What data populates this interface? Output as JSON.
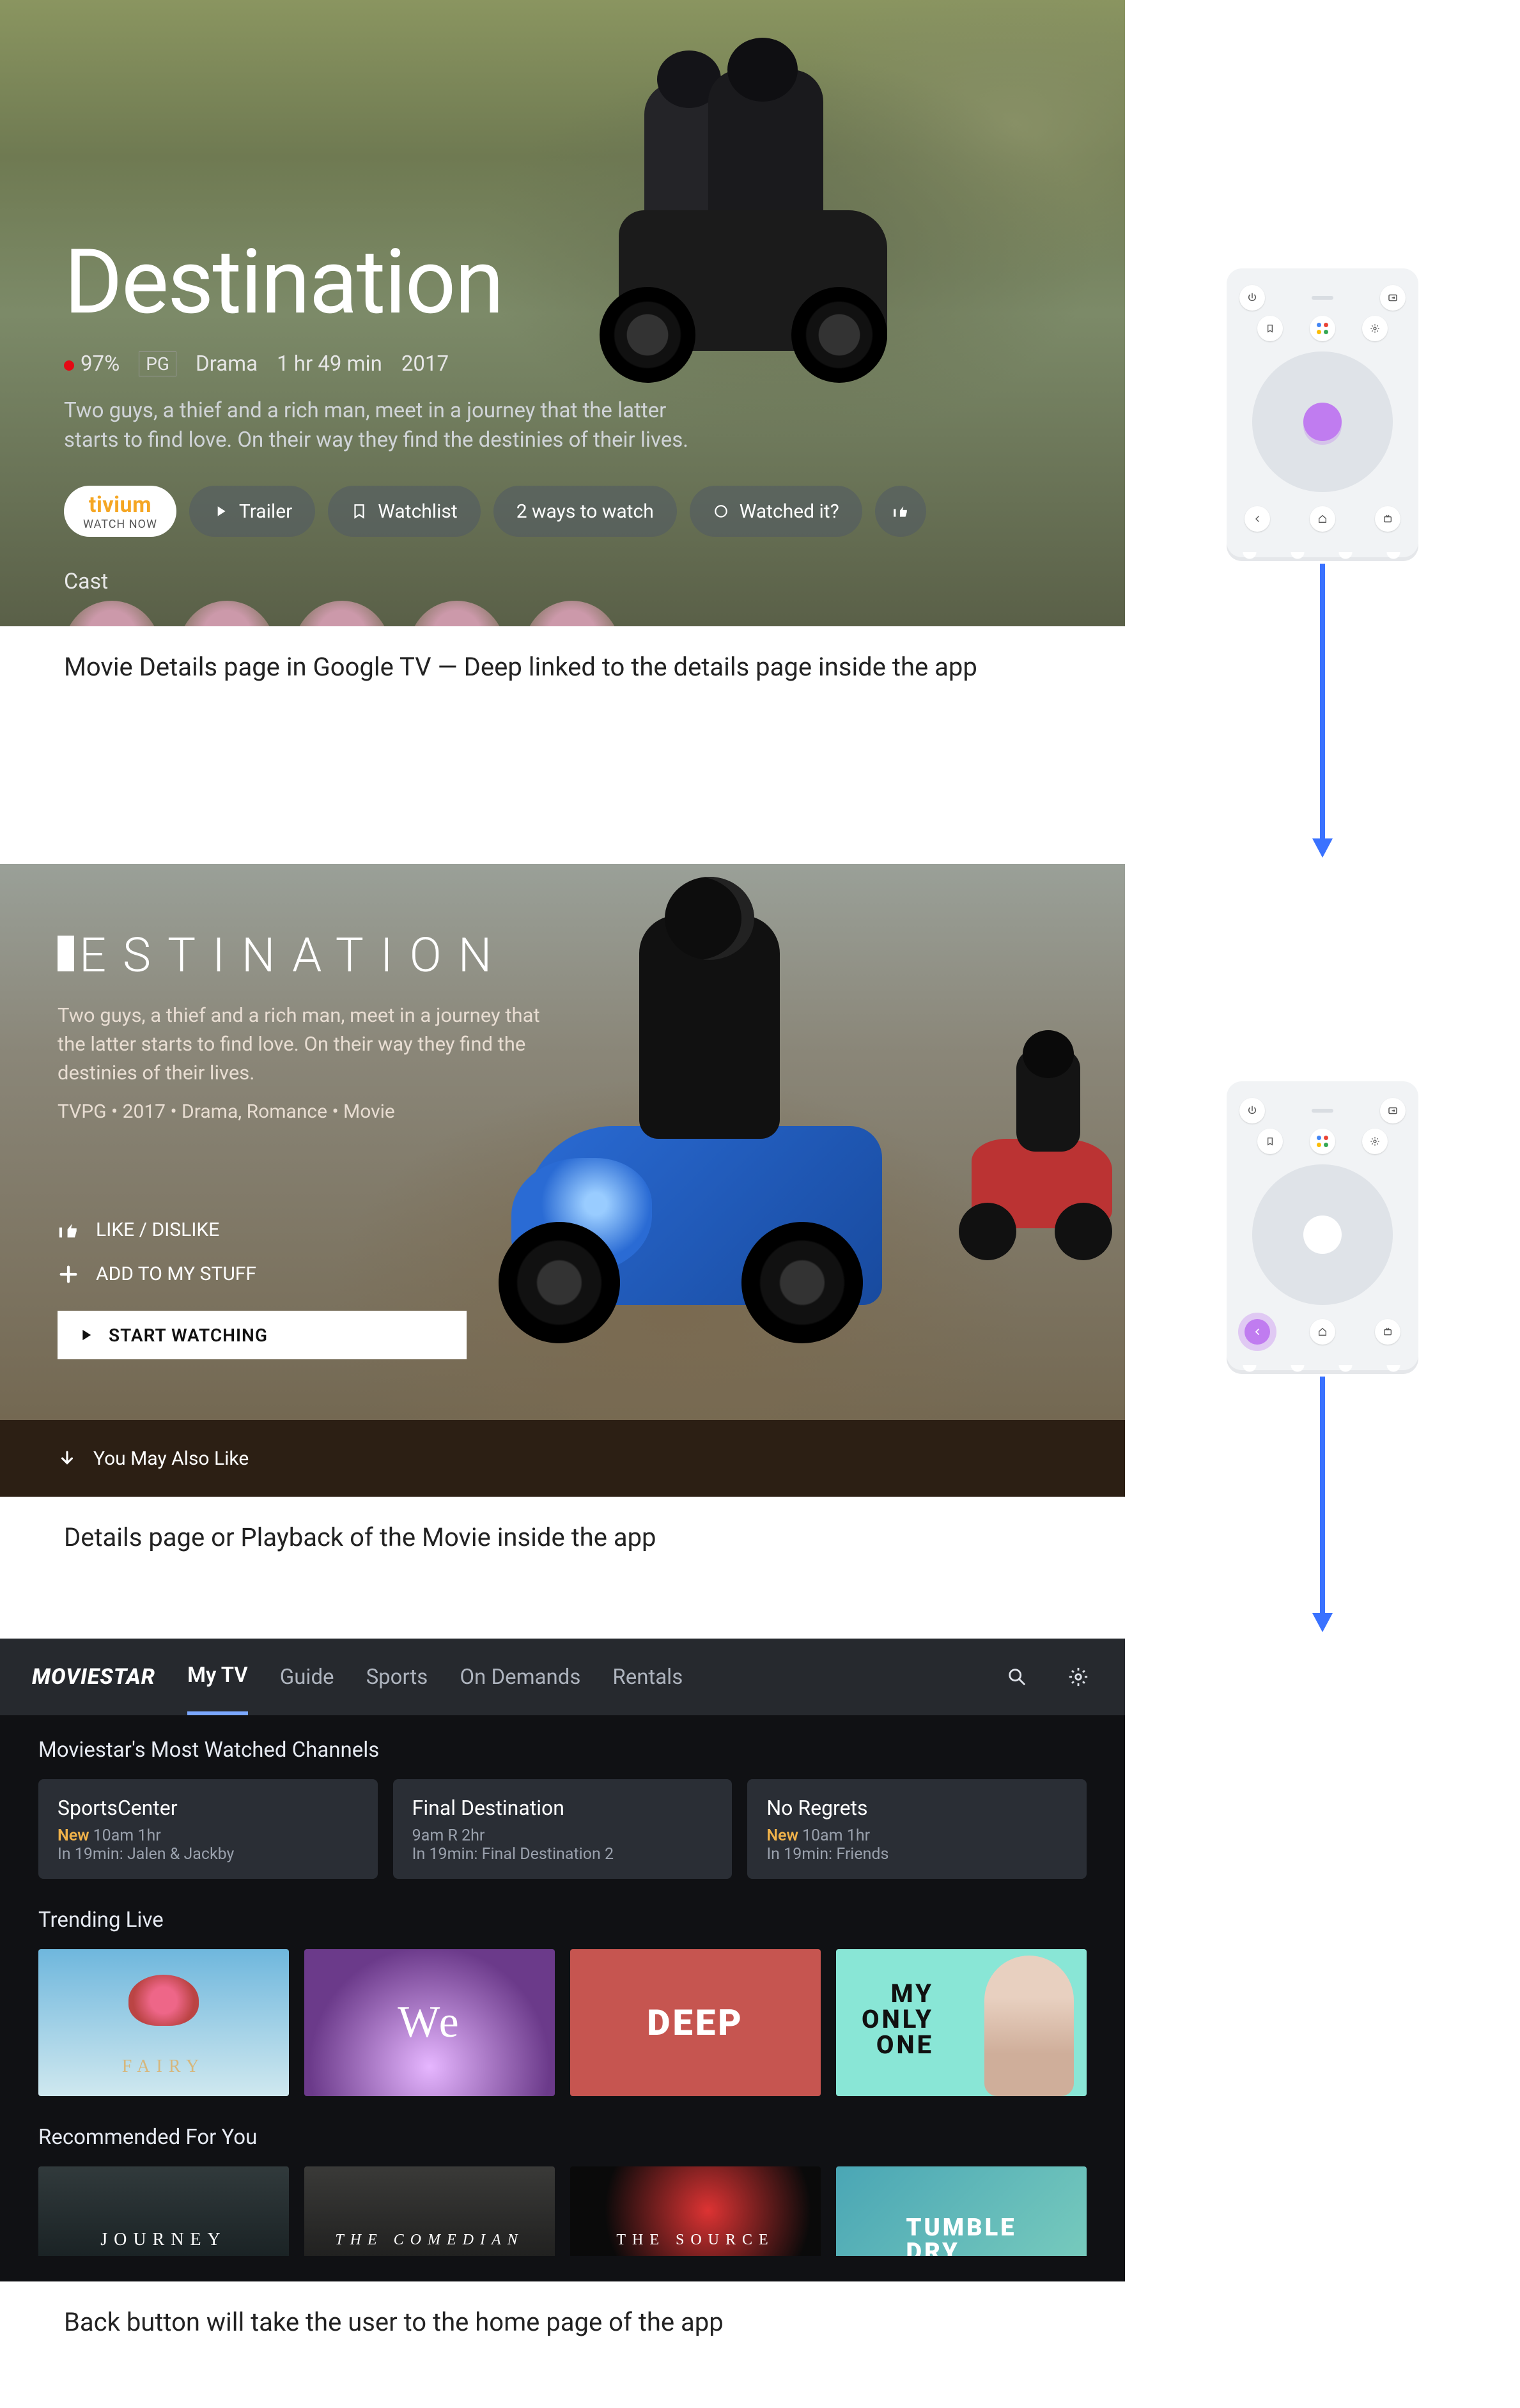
{
  "captions": {
    "c1": "Movie Details page in Google TV — Deep linked to the details page inside the app",
    "c2": "Details page or Playback of the Movie inside the app",
    "c3": "Back button will take the user to the home page of the app"
  },
  "gtv": {
    "title": "Destination",
    "score": "97%",
    "rating": "PG",
    "genre": "Drama",
    "runtime": "1 hr 49 min",
    "year": "2017",
    "description": "Two guys, a thief and a rich man, meet in a journey that the latter starts to find love. On their way they find the destinies of their lives.",
    "provider_brand": "tivium",
    "provider_sub": "WATCH NOW",
    "btn_trailer": "Trailer",
    "btn_watchlist": "Watchlist",
    "btn_ways": "2 ways to watch",
    "btn_watched": "Watched it?",
    "cast_label": "Cast"
  },
  "app": {
    "title": "ESTINATION",
    "description": "Two guys, a thief and a rich man, meet in a journey that the latter starts to find love. On their way they find the destinies of their lives.",
    "meta": "TVPG • 2017 • Drama, Romance • Movie",
    "btn_like": "LIKE / DISLIKE",
    "btn_add": "ADD TO MY STUFF",
    "btn_start": "START WATCHING",
    "also": "You May Also Like"
  },
  "ms": {
    "logo": "MOVIESTAR",
    "tabs": [
      "My TV",
      "Guide",
      "Sports",
      "On Demands",
      "Rentals"
    ],
    "active_tab": 0,
    "sec_watched": "Moviestar's Most Watched Channels",
    "cards": [
      {
        "title": "SportsCenter",
        "new": true,
        "time": "10am 1hr",
        "next": "In 19min: Jalen & Jackby"
      },
      {
        "title": "Final Destination",
        "new": false,
        "time": "9am R 2hr",
        "next": "In 19min: Final Destination 2"
      },
      {
        "title": "No Regrets",
        "new": true,
        "time": "10am 1hr",
        "next": "In 19min: Friends"
      }
    ],
    "sec_trending": "Trending Live",
    "trending": [
      "FAIRY",
      "We",
      "DEEP",
      "MY ONLY ONE"
    ],
    "sec_rec": "Recommended For You",
    "rec": [
      "JOURNEY",
      "THE COMEDIAN",
      "THE SOURCE",
      "TUMBLE DRY"
    ]
  },
  "labels": {
    "new": "New"
  }
}
